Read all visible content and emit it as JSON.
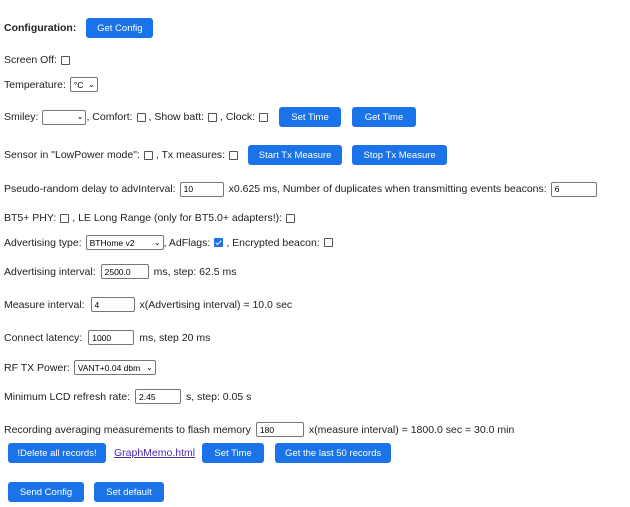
{
  "configuration": {
    "title": "Configuration:",
    "get_config_button": "Get Config"
  },
  "screen_off": {
    "label": "Screen Off:"
  },
  "temperature": {
    "label": "Temperature:",
    "selected": "°C"
  },
  "smiley_row": {
    "smiley_label": "Smiley:",
    "smiley_selected": "",
    "comfort_label": ", Comfort:",
    "show_batt_label": ", Show batt:",
    "clock_label": ", Clock:",
    "set_time_button": "Set Time",
    "get_time_button": "Get Time"
  },
  "sensor_row": {
    "sensor_label": "Sensor in \"LowPower mode\":",
    "tx_label": ", Tx measures:",
    "start_button": "Start Tx Measure",
    "stop_button": "Stop Tx Measure"
  },
  "delay_row": {
    "label": "Pseudo-random delay to advInterval:",
    "value": "10",
    "mid_text": "x0.625 ms, Number of duplicates when transmitting events beacons:",
    "duplicates": "6"
  },
  "phy_row": {
    "label": "BT5+ PHY:",
    "long_range_label": ", LE Long Range (only for BT5.0+ adapters!):"
  },
  "adv_type_row": {
    "label": "Advertising type:",
    "selected": "BTHome v2",
    "adflags_label": ", AdFlags:",
    "adflags_checked": true,
    "encrypted_label": ", Encrypted beacon:"
  },
  "adv_interval": {
    "label": "Advertising interval:",
    "value": "2500.0",
    "suffix": "ms, step: 62.5 ms"
  },
  "measure_interval": {
    "label": "Measure interval:",
    "value": "4",
    "suffix": "x(Advertising interval) = 10.0 sec"
  },
  "connect_latency": {
    "label": "Connect latency:",
    "value": "1000",
    "suffix": "ms, step 20 ms"
  },
  "rf_tx": {
    "label": "RF TX Power:",
    "selected": "VANT+0.04 dbm"
  },
  "lcd_refresh": {
    "label": "Minimum LCD refresh rate:",
    "value": "2.45",
    "suffix": "s, step: 0.05 s"
  },
  "recording": {
    "label": "Recording averaging measurements to flash memory",
    "value": "180",
    "suffix": "x(measure interval) = 1800.0 sec = 30.0 min"
  },
  "records_row": {
    "delete_button": "!Delete all records!",
    "graph_link": "GraphMemo.html",
    "set_time_button": "Set Time",
    "get_last_button": "Get the last 50 records"
  },
  "bottom_row": {
    "send_button": "Send Config",
    "default_button": "Set default"
  },
  "colors": {
    "accent": "#1a73e8",
    "link": "#4b2aa8"
  }
}
